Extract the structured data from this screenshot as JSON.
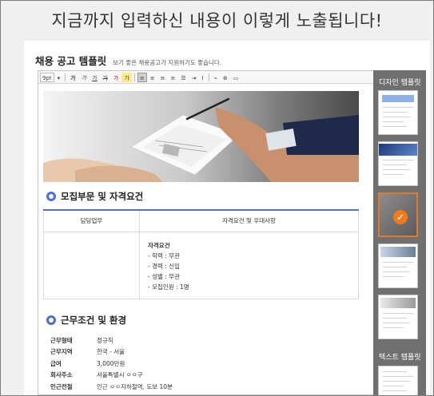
{
  "banner": {
    "title": "지금까지 입력하신 내용이 이렇게 노출됩니다!"
  },
  "template": {
    "title": "채용 공고 템플릿",
    "description": "보기 좋은 채용공고가 지원하기도 좋습니다."
  },
  "toolbar": {
    "font_size": "9pt",
    "items": [
      "가",
      "가",
      "가",
      "가",
      "가",
      "가"
    ]
  },
  "section1": {
    "title": "모집부문 및 자격요건",
    "col_header_1": "담당업무",
    "col_header_2": "자격요건 및 우대사항",
    "qual_title": "자격요건",
    "quals": [
      "- 학력 : 무관",
      "- 경력 : 신입",
      "- 성별 : 무관",
      "- 모집인원 : 1명"
    ]
  },
  "section2": {
    "title": "근무조건 및 환경",
    "rows": [
      {
        "key": "근무형태",
        "value": "정규직"
      },
      {
        "key": "근무지역",
        "value": "한국 - 서울"
      },
      {
        "key": "급여",
        "value": "3,000만원"
      },
      {
        "key": "회사주소",
        "value": "서울특별시 ㅇㅇ구"
      },
      {
        "key": "인근전철",
        "value": "인근 ㅇㅇ지하철역, 도보 10분"
      }
    ]
  },
  "sidebar": {
    "design_label": "디자인 템플릿",
    "text_label": "텍스트 템플릿",
    "check_glyph": "✓",
    "accent": "#f07b1e"
  },
  "colors": {
    "section_blue": "#4a6fd0"
  }
}
